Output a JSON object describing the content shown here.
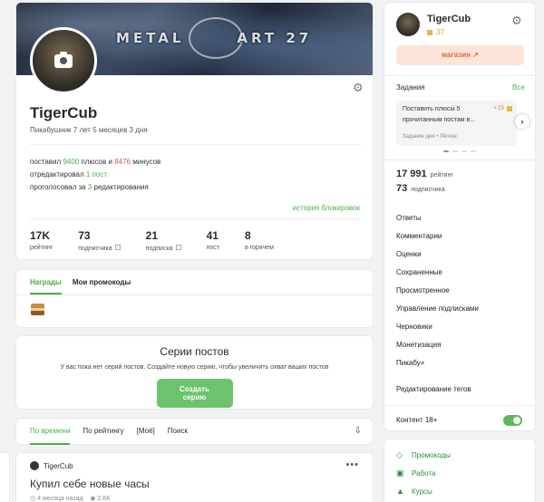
{
  "profile": {
    "banner_text": "METAL",
    "banner_text2": "ART 27",
    "username": "TigerCub",
    "member_since": "Пикабушник 7 лет 5 месяцев 3 дня",
    "votes_prefix": "поставил",
    "pluses": "9400",
    "pluses_word": "плюсов и",
    "minuses": "8476",
    "minuses_word": "минусов",
    "edited_prefix": "отредактировал",
    "edited_value": "1 пост",
    "voted_prefix": "проголосовал за",
    "voted_value": "3",
    "voted_suffix": "редактирования",
    "history_link": "история блокировок",
    "stats": [
      {
        "value": "17K",
        "label": "рейтинг"
      },
      {
        "value": "73",
        "label": "подписчика"
      },
      {
        "value": "21",
        "label": "подписка"
      },
      {
        "value": "41",
        "label": "пост"
      },
      {
        "value": "8",
        "label": "в горячем"
      }
    ]
  },
  "awards": {
    "tabs": [
      "Награды",
      "Мои промокоды"
    ]
  },
  "series": {
    "title": "Серии постов",
    "text": "У вас пока нет серий постов. Создайте новую серию, чтобы увеличить охват ваших постов",
    "button": "Создать серию"
  },
  "sort": {
    "tabs": [
      "По времени",
      "По рейтингу",
      "[Моё]",
      "Поиск"
    ]
  },
  "post": {
    "author": "TigerCub",
    "title": "Купил себе новые часы",
    "time": "4 месяца назад",
    "views": "2.6K"
  },
  "sidebar": {
    "username": "TigerCub",
    "rating_small": "37",
    "shop": "магазин",
    "tasks_label": "Задания",
    "tasks_all": "Все",
    "task_title": "Поставить плюсы 5 прочитанным постам в...",
    "task_reward": "+15",
    "task_meta": "Задание дня • Лёгкое",
    "rating_value": "17 991",
    "rating_label": "рейтинг",
    "subs_value": "73",
    "subs_label": "подписчика",
    "menu": [
      "Ответы",
      "Комментарии",
      "Оценки",
      "Сохраненные",
      "Просмотренное",
      "Управление подписками",
      "Черновики",
      "Монетизация",
      "Пикабу+",
      "Редактирование тегов"
    ],
    "content18": "Контент 18+",
    "links": [
      "Промокоды",
      "Работа",
      "Курсы"
    ]
  },
  "colors": {
    "accent_green": "#4cae4c",
    "minus_red": "#d9534f",
    "shop_orange": "#e8663c"
  }
}
